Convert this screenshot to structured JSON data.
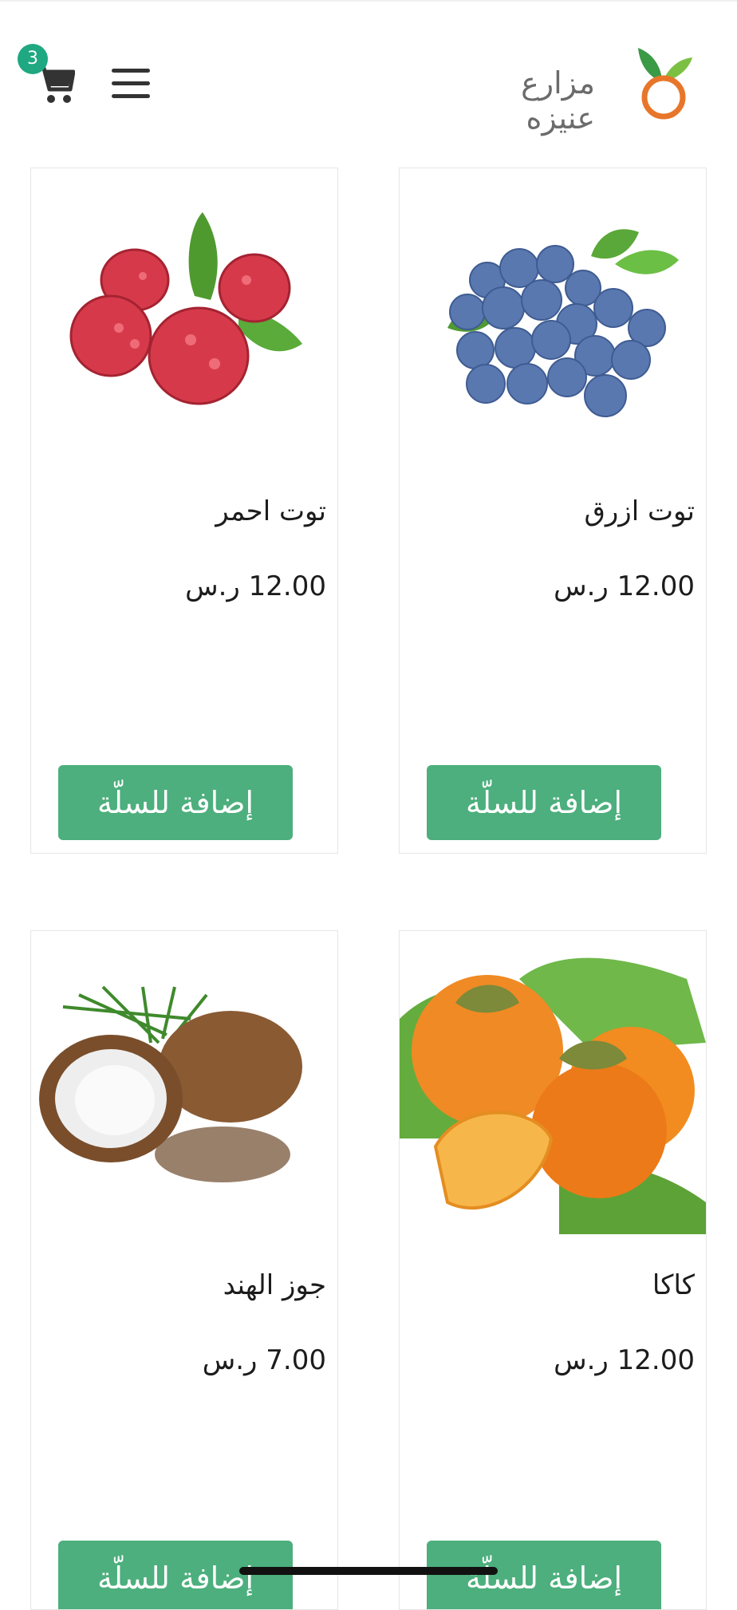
{
  "header": {
    "brand_name": "مزارع عنيزه",
    "cart_count": "3"
  },
  "products": [
    {
      "name": "توت ازرق",
      "price": "12.00 ر.س",
      "button_label": "إضافة للسلّة"
    },
    {
      "name": "توت احمر",
      "price": "12.00 ر.س",
      "button_label": "إضافة للسلّة"
    },
    {
      "name": "كاكا",
      "price": "12.00 ر.س",
      "button_label": "إضافة للسلّة"
    },
    {
      "name": "جوز الهند",
      "price": "7.00 ر.س",
      "button_label": "إضافة للسلّة"
    }
  ],
  "colors": {
    "accent_green": "#4caf7d",
    "badge_green": "#1fa882",
    "logo_orange": "#e8762a"
  },
  "icons": [
    "logo-leaf-icon",
    "hamburger-menu-icon",
    "cart-icon"
  ]
}
